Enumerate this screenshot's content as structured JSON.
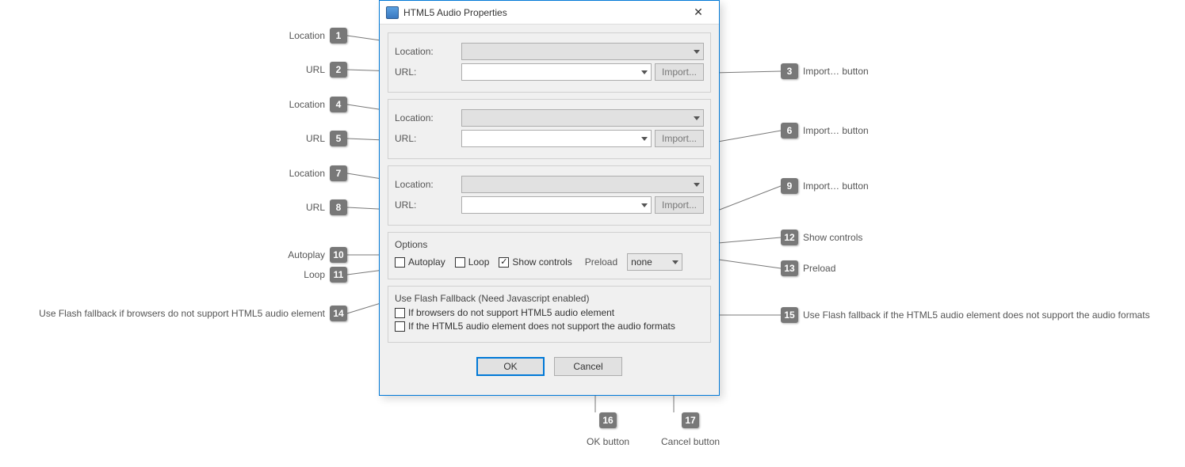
{
  "dialog": {
    "title": "HTML5 Audio Properties",
    "groups": [
      {
        "location_label": "Location:",
        "url_label": "URL:",
        "import_label": "Import..."
      },
      {
        "location_label": "Location:",
        "url_label": "URL:",
        "import_label": "Import..."
      },
      {
        "location_label": "Location:",
        "url_label": "URL:",
        "import_label": "Import..."
      }
    ],
    "options": {
      "legend": "Options",
      "autoplay": "Autoplay",
      "loop": "Loop",
      "show_controls": "Show controls",
      "preload_label": "Preload",
      "preload_value": "none"
    },
    "fallback": {
      "legend": "Use Flash Fallback (Need Javascript enabled)",
      "opt1": "If browsers do not support HTML5 audio element",
      "opt2": "If the HTML5 audio element does not support the audio formats"
    },
    "buttons": {
      "ok": "OK",
      "cancel": "Cancel"
    }
  },
  "annotations": {
    "a1": "Location",
    "a2": "URL",
    "a3": "Import… button",
    "a4": "Location",
    "a5": "URL",
    "a6": "Import… button",
    "a7": "Location",
    "a8": "URL",
    "a9": "Import… button",
    "a10": "Autoplay",
    "a11": "Loop",
    "a12": "Show controls",
    "a13": "Preload",
    "a14": "Use Flash fallback if browsers do not support HTML5 audio element",
    "a15": "Use Flash fallback if the HTML5 audio element does not support the audio formats",
    "a16": "OK button",
    "a17": "Cancel button"
  }
}
